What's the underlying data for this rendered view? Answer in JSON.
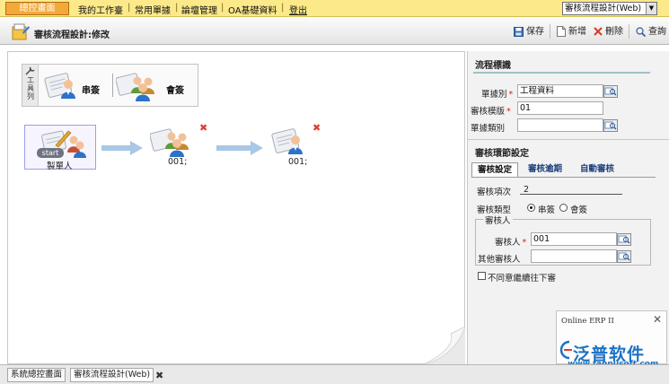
{
  "menubar": {
    "home": "總控畫面",
    "items": [
      "我的工作臺",
      "常用單據",
      "論壇管理",
      "OA基礎資料",
      "登出"
    ],
    "module_select": "審核流程設計(Web)"
  },
  "toolbar": {
    "title": "審核流程設計:修改",
    "save": "保存",
    "add": "新增",
    "delete": "刪除",
    "query": "查詢"
  },
  "canvas": {
    "toolbox_label": "工具列",
    "tool_serial": "串簽",
    "tool_joint": "會簽",
    "start_pill": "start",
    "nodes": [
      "製單人",
      "001;",
      "001;"
    ]
  },
  "flow_id": {
    "title": "流程標識",
    "doc_type_label": "單據別",
    "doc_type_value": "工程資料",
    "template_label": "審核模版",
    "template_value": "01",
    "doc_category_label": "單據類別",
    "doc_category_value": ""
  },
  "step": {
    "title": "審核環節設定",
    "tabs": [
      "審核設定",
      "審核逾期",
      "自動審核"
    ],
    "order_label": "審核項次",
    "order_value": "2",
    "type_label": "審核類型",
    "type_options": [
      "串簽",
      "會簽"
    ],
    "type_selected": "串簽",
    "reviewer_group": "審核人",
    "reviewer_label": "審核人",
    "reviewer_value": "001",
    "other_label": "其他審核人",
    "other_value": "",
    "disagree_label": "不同意繼續往下審"
  },
  "popup": {
    "title": "Online ERP II",
    "brand": "泛普软件",
    "url": "www.fanpusoft.com"
  },
  "bottom_tabs": [
    "系統總控畫面",
    "審核流程設計(Web)"
  ],
  "colors": {
    "menubar": "#fbe98a",
    "home_button": "#f3a93a",
    "accent_blue": "#1d72c4",
    "delete_red": "#e03c2e"
  }
}
